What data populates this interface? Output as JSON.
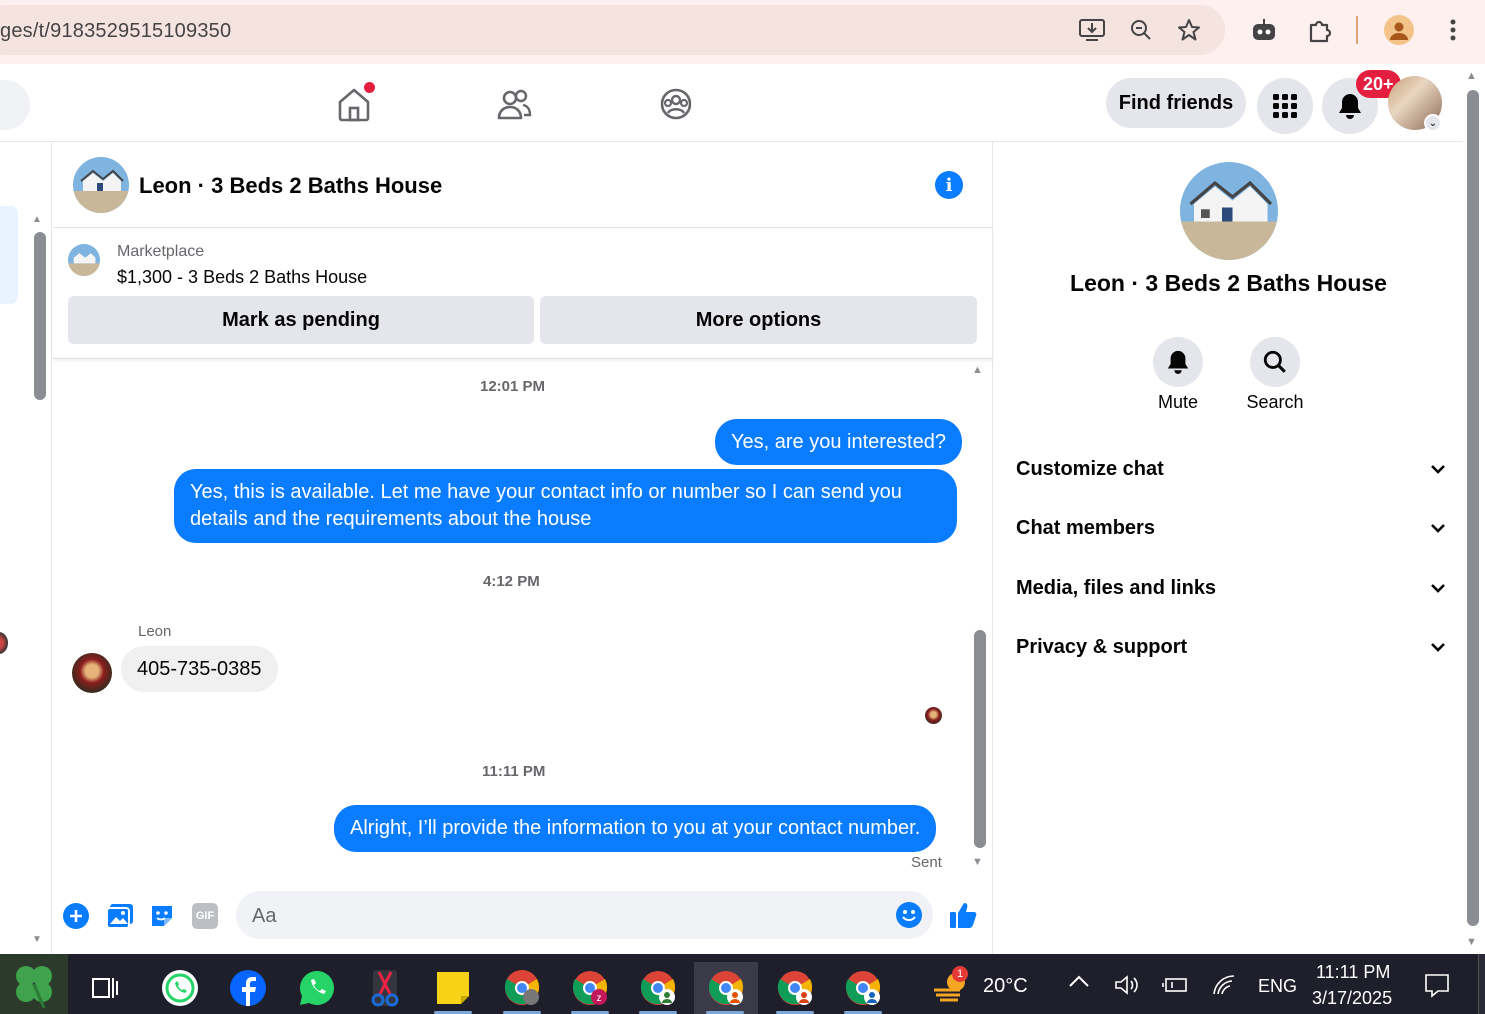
{
  "browser": {
    "url": "ges/t/9183529515109350"
  },
  "header": {
    "find_friends": "Find friends",
    "notification_count": "20+"
  },
  "chat": {
    "title": "Leon · 3 Beds 2 Baths House",
    "marketplace_label": "Marketplace",
    "listing_title": "$1,300 - 3 Beds 2 Baths House",
    "mark_pending": "Mark as pending",
    "more_options": "More options",
    "messages": [
      {
        "type": "timestamp",
        "text": "12:01 PM"
      },
      {
        "type": "out",
        "text": "Yes, are you interested?"
      },
      {
        "type": "out",
        "text": "Yes, this is available. Let me have your contact info or number so I can send you details and the requirements about the house"
      },
      {
        "type": "timestamp",
        "text": "4:12 PM"
      },
      {
        "type": "in",
        "sender": "Leon",
        "text": "405-735-0385"
      },
      {
        "type": "timestamp",
        "text": "11:11 PM"
      },
      {
        "type": "out",
        "text": "Alright, I’ll provide the information to you at your contact number."
      }
    ],
    "sent_status": "Sent",
    "composer_placeholder": "Aa"
  },
  "details": {
    "name": "Leon · 3 Beds 2 Baths House",
    "mute": "Mute",
    "search": "Search",
    "sections": [
      "Customize chat",
      "Chat members",
      "Media, files and links",
      "Privacy & support"
    ]
  },
  "taskbar": {
    "weather_temp": "20°C",
    "weather_badge": "1",
    "language": "ENG",
    "time": "11:11 PM",
    "date": "3/17/2025"
  },
  "colors": {
    "accent": "#0a7cff",
    "badge": "#e41e3f"
  }
}
